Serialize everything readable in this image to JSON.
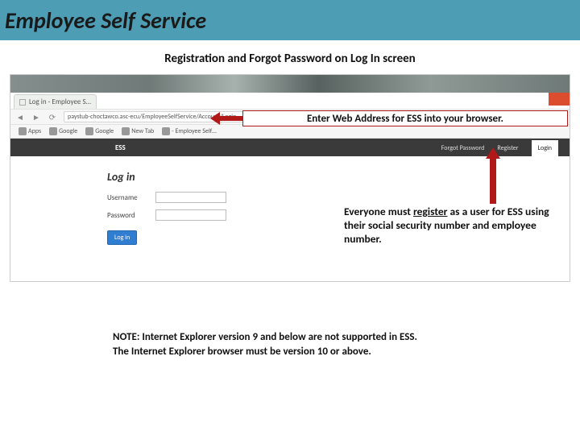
{
  "banner": {
    "title": "Employee Self Service"
  },
  "subtitle": "Registration and Forgot Password on Log In screen",
  "browser": {
    "tab_label": "Log in - Employee S…",
    "url": "paystub-choctawco.asc-ecu/EmployeeSelfService/Account/Login",
    "bookmarks": [
      "Apps",
      "Google",
      "Google",
      "New Tab",
      "- Employee Self…"
    ]
  },
  "app": {
    "brand": "ESS",
    "nav": {
      "forgot": "Forgot Password",
      "register": "Register",
      "login": "Login"
    },
    "login_heading": "Log in",
    "username_label": "Username",
    "password_label": "Password",
    "login_button": "Log in"
  },
  "callouts": {
    "address": "Enter Web Address for ESS into your browser.",
    "register_line1": "Everyone must ",
    "register_underline": "register",
    "register_line2": " as a user for ESS using their social security number and employee number."
  },
  "note": {
    "line1": "NOTE:  Internet Explorer version 9 and below are not supported in ESS.",
    "line2": "The Internet Explorer browser must be version 10 or above."
  }
}
